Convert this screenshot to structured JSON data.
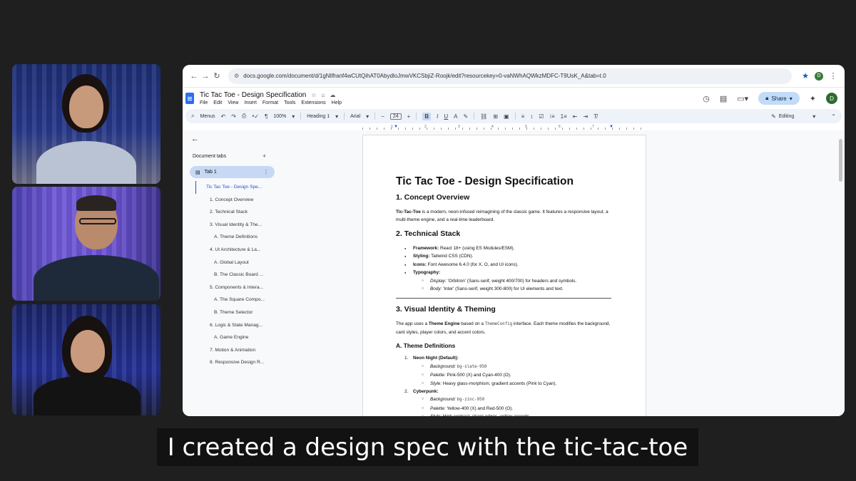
{
  "browser": {
    "url": "docs.google.com/document/d/1gNllfranf4wCUtQihAT0AbydloJmwVKCSbjiZ-Roojk/edit?resourcekey=0-vaNWhAQWkzMDFC-T9UsK_A&tab=t.0",
    "profile_initial": "D"
  },
  "doc": {
    "title": "Tic Tac Toe - Design Specification",
    "menus": [
      "File",
      "Edit",
      "View",
      "Insert",
      "Format",
      "Tools",
      "Extensions",
      "Help"
    ],
    "share_label": "Share",
    "avatar_initial": "D"
  },
  "toolbar": {
    "menus_label": "Menus",
    "zoom": "100%",
    "style": "Heading 1",
    "font": "Arial",
    "font_size": "24",
    "editing_label": "Editing"
  },
  "sidebar": {
    "tabs_label": "Document tabs",
    "tab_name": "Tab 1",
    "outline": [
      {
        "label": "Tic Tac Toe - Design Spe...",
        "level": 0
      },
      {
        "label": "1. Concept Overview",
        "level": 1
      },
      {
        "label": "2. Technical Stack",
        "level": 1
      },
      {
        "label": "3. Visual Identity & The...",
        "level": 1
      },
      {
        "label": "A. Theme Definitions",
        "level": 2
      },
      {
        "label": "4. UI Architecture & La...",
        "level": 1
      },
      {
        "label": "A. Global Layout",
        "level": 2
      },
      {
        "label": "B. The Classic Board ...",
        "level": 2
      },
      {
        "label": "5. Components & Intera...",
        "level": 1
      },
      {
        "label": "A. The Square Compo...",
        "level": 2
      },
      {
        "label": "B. Theme Selector",
        "level": 2
      },
      {
        "label": "6. Logic & State Manag...",
        "level": 1
      },
      {
        "label": "A. Game Engine",
        "level": 2
      },
      {
        "label": "7. Motion & Animation",
        "level": 1
      },
      {
        "label": "8. Responsive Design R...",
        "level": 1
      }
    ]
  },
  "page": {
    "title": "Tic Tac Toe - Design Specification",
    "s1_heading": "1. Concept Overview",
    "s1_bold": "Tic-Tac-Toe",
    "s1_text": " is a modern, neon-infused reimagining of the classic game. It features a responsive layout, a multi-theme engine, and a real-time leaderboard.",
    "s2_heading": "2. Technical Stack",
    "stack": [
      {
        "label": "Framework:",
        "text": " React 18+ (using ES Modules/ESM)."
      },
      {
        "label": "Styling:",
        "text": " Tailwind CSS (CDN)."
      },
      {
        "label": "Icons:",
        "text": " Font Awesome 6.4.0 (for X, O, and UI icons)."
      },
      {
        "label": "Typography:",
        "text": ""
      }
    ],
    "typography": [
      {
        "label": "Display:",
        "text": " 'Orbitron' (Sans-serif, weight 400/700) for headers and symbols."
      },
      {
        "label": "Body:",
        "text": " 'Inter' (Sans-serif, weight 300-800) for UI elements and text."
      }
    ],
    "s3_heading": "3. Visual Identity & Theming",
    "s3_pre": "The app uses a ",
    "s3_bold": "Theme Engine",
    "s3_mid": " based on a ",
    "s3_code": "ThemeConfig",
    "s3_post": " interface. Each theme modifies the background, card styles, player colors, and accent colors.",
    "s3a_heading": "A. Theme Definitions",
    "themes": [
      {
        "num": "1.",
        "name": "Neon Night (Default):",
        "background_label": "Background:",
        "background_code": "bg-slate-950",
        "palette_label": "Palette:",
        "palette": " Pink-500 (X) and Cyan-400 (O).",
        "style_label": "Style:",
        "style": " Heavy glass-morphism, gradient accents (Pink to Cyan)."
      },
      {
        "num": "2.",
        "name": "Cyberpunk:",
        "background_label": "Background:",
        "background_code": "bg-zinc-950",
        "palette_label": "Palette:",
        "palette": " Yellow-400 (X) and Red-500 (O).",
        "style_label": "Style:",
        "style": " High contrast, sharp edges, yellow accents."
      }
    ]
  },
  "caption": "I created a design spec with the tic-tac-toe"
}
